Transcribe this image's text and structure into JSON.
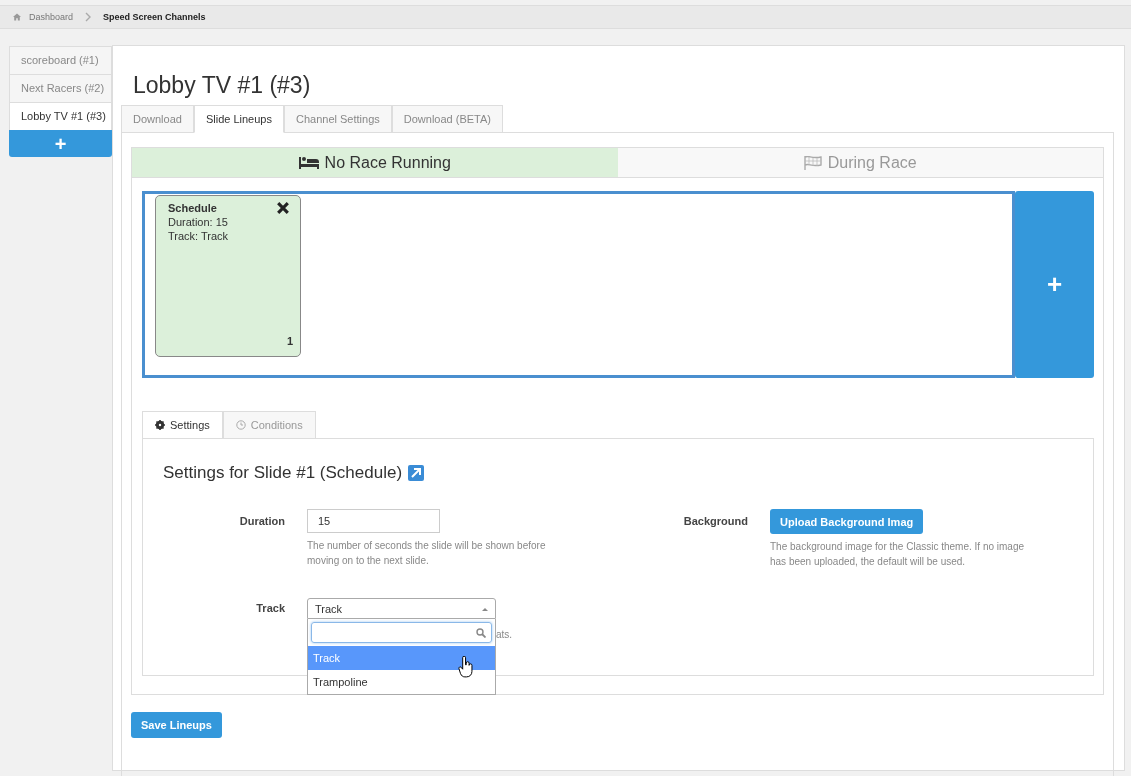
{
  "breadcrumb": [
    {
      "label": "Dashboard",
      "current": false
    },
    {
      "label": "Speed Screen Channels",
      "current": true
    }
  ],
  "sidebar": {
    "items": [
      {
        "label": "scoreboard (#1)",
        "selected": false
      },
      {
        "label": "Next Racers (#2)",
        "selected": false
      },
      {
        "label": "Lobby TV #1 (#3)",
        "selected": true
      }
    ],
    "add_button": "+"
  },
  "title": "Lobby TV #1 (#3)",
  "tabs": [
    {
      "label": "Download",
      "selected": false
    },
    {
      "label": "Slide Lineups",
      "selected": true
    },
    {
      "label": "Channel Settings",
      "selected": false
    },
    {
      "label": "Download (BETA)",
      "selected": false
    }
  ],
  "race_toggle": [
    {
      "label": "No Race Running",
      "kind": "bed",
      "selected": true
    },
    {
      "label": "During Race",
      "kind": "flag",
      "selected": false
    }
  ],
  "slides": [
    {
      "name": "Schedule",
      "lines": [
        "Duration: 15",
        "Track: Track"
      ],
      "number": "1"
    }
  ],
  "add_slide_button": "+",
  "settings_tabs": [
    {
      "label": "Settings",
      "kind": "gear",
      "selected": true
    },
    {
      "label": "Conditions",
      "kind": "clock",
      "selected": false
    }
  ],
  "settings": {
    "heading": "Settings for Slide #1 (Schedule)",
    "duration": {
      "label": "Duration",
      "value": "15",
      "help": "The number of seconds the slide will be shown before moving on to the next slide."
    },
    "background": {
      "label": "Background",
      "button": "Upload Background Imag",
      "help": "The background image for the Classic theme. If no image has been uploaded, the default will be used."
    },
    "track": {
      "label": "Track",
      "value": "Track",
      "help": "ats.",
      "options": [
        {
          "label": "Track",
          "selected": true
        },
        {
          "label": "Trampoline",
          "selected": false
        }
      ]
    }
  },
  "save_button": "Save Lineups"
}
